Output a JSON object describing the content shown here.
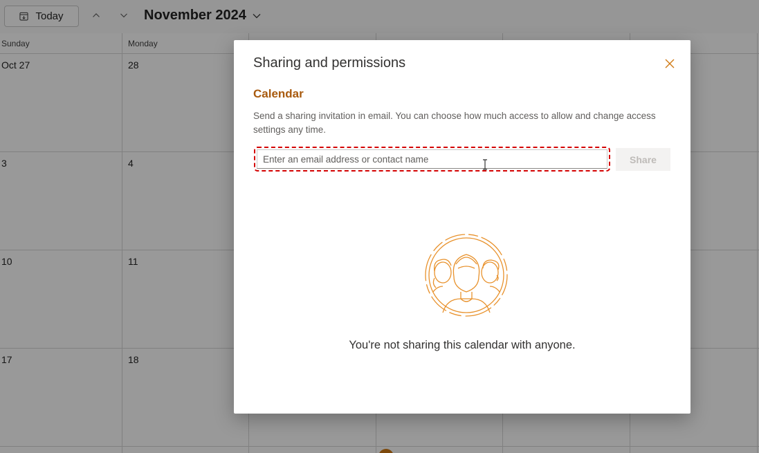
{
  "toolbar": {
    "today_label": "Today",
    "month_label": "November 2024"
  },
  "calendar": {
    "day_headers": [
      "Sunday",
      "Monday"
    ],
    "weeks": [
      [
        "Oct 27",
        "28"
      ],
      [
        "3",
        "4"
      ],
      [
        "10",
        "11"
      ],
      [
        "17",
        "18"
      ]
    ]
  },
  "dialog": {
    "title": "Sharing and permissions",
    "calendar_name": "Calendar",
    "description": "Send a sharing invitation in email. You can choose how much access to allow and change access settings any time.",
    "email_placeholder": "Enter an email address or contact name",
    "email_value": "",
    "share_label": "Share",
    "empty_message": "You're not sharing this calendar with anyone."
  },
  "colors": {
    "accent": "#d07a14",
    "calendar_name": "#a85a0e",
    "highlight_border": "#d40000"
  },
  "icons": {
    "today": "calendar-today-icon",
    "prev": "chevron-up-icon",
    "next": "chevron-down-icon",
    "month_picker": "chevron-down-icon",
    "close": "close-icon",
    "illustration": "people-sharing-illustration"
  }
}
